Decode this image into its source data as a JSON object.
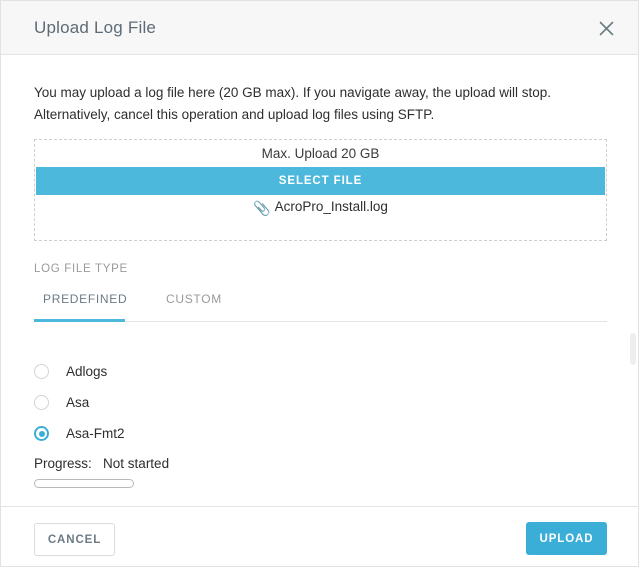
{
  "dialog": {
    "title": "Upload Log File",
    "close_icon": "close-icon",
    "intro": "You may upload a log file here (20 GB max). If you navigate away, the upload will stop. Alternatively, cancel this operation and upload log files using SFTP."
  },
  "dropzone": {
    "max_upload_label": "Max. Upload 20 GB",
    "select_file_label": "SELECT FILE",
    "attachment_icon": "paperclip-icon",
    "selected_file": "AcroPro_Install.log"
  },
  "log_file_type": {
    "section_label": "LOG FILE TYPE",
    "tabs": [
      {
        "label": "PREDEFINED",
        "active": true
      },
      {
        "label": "CUSTOM",
        "active": false
      }
    ],
    "options": [
      {
        "label": "Adlogs",
        "selected": false
      },
      {
        "label": "Asa",
        "selected": false
      },
      {
        "label": "Asa-Fmt2",
        "selected": true
      }
    ]
  },
  "progress": {
    "label": "Progress:",
    "status": "Not started",
    "percent": 0
  },
  "footer": {
    "cancel_label": "CANCEL",
    "upload_label": "UPLOAD"
  },
  "colors": {
    "accent": "#4cb8dc",
    "accent_dark": "#3aaed6",
    "header_bg": "#f7f7f7",
    "border": "#e4e4e4",
    "text": "#2e2e2e",
    "muted": "#9a9a9a"
  }
}
